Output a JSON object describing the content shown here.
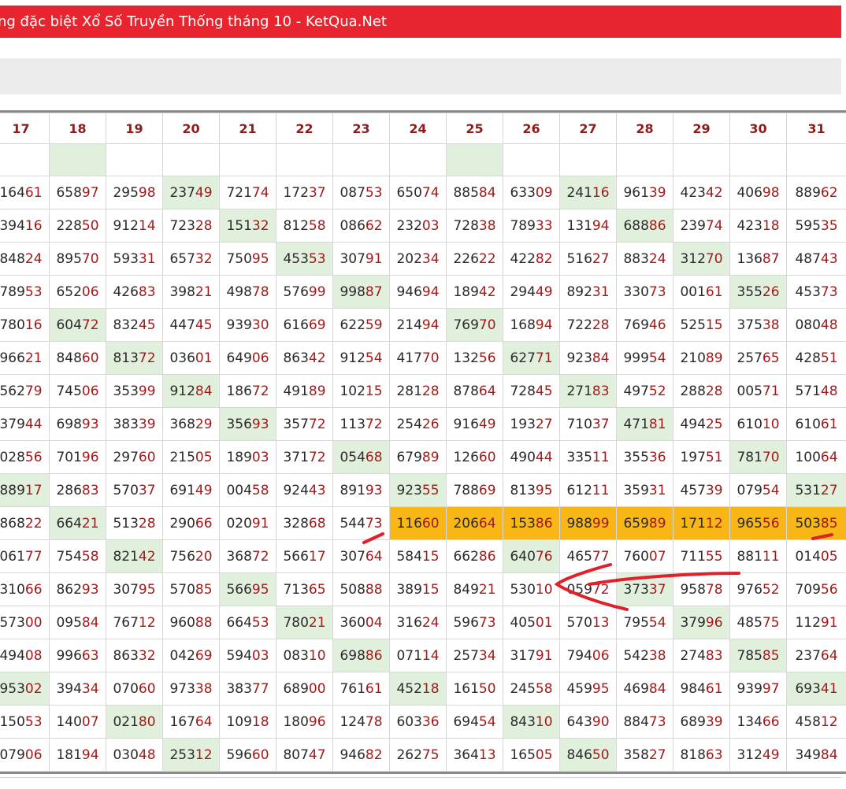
{
  "header": {
    "title": "ng đặc biệt Xổ Số Truyền Thống tháng 10 - KetQua.Net"
  },
  "table": {
    "columns": [
      "17",
      "18",
      "19",
      "20",
      "21",
      "22",
      "23",
      "24",
      "25",
      "26",
      "27",
      "28",
      "29",
      "30",
      "31"
    ],
    "first_row_green": [
      1,
      8
    ],
    "rows": [
      [
        "16461",
        "65897",
        "29598",
        "23749",
        "72174",
        "17237",
        "08753",
        "65074",
        "88584",
        "63309",
        "24116",
        "96139",
        "42342",
        "40698",
        "88962"
      ],
      [
        "39416",
        "22850",
        "91214",
        "72328",
        "15132",
        "81258",
        "08662",
        "23203",
        "72838",
        "78933",
        "13194",
        "68886",
        "23974",
        "42318",
        "59535"
      ],
      [
        "84824",
        "89570",
        "59331",
        "65732",
        "75095",
        "45353",
        "30791",
        "20234",
        "22622",
        "42282",
        "51627",
        "88324",
        "31270",
        "13687",
        "48743"
      ],
      [
        "78953",
        "65206",
        "42683",
        "39821",
        "49878",
        "57699",
        "99887",
        "94694",
        "18942",
        "29449",
        "89231",
        "33073",
        "00161",
        "35526",
        "45373"
      ],
      [
        "78016",
        "60472",
        "83245",
        "44745",
        "93930",
        "61669",
        "62259",
        "21494",
        "76970",
        "16894",
        "72228",
        "76946",
        "52515",
        "37538",
        "08048"
      ],
      [
        "96621",
        "84860",
        "81372",
        "03601",
        "64906",
        "86342",
        "91254",
        "41770",
        "13256",
        "62771",
        "92384",
        "99954",
        "21089",
        "25765",
        "42851"
      ],
      [
        "56279",
        "74506",
        "35399",
        "91284",
        "18672",
        "49189",
        "10215",
        "28128",
        "87864",
        "72845",
        "27183",
        "49752",
        "28828",
        "00571",
        "57148"
      ],
      [
        "37944",
        "69893",
        "38339",
        "36829",
        "35693",
        "35772",
        "11372",
        "25426",
        "91649",
        "19327",
        "71037",
        "47181",
        "49425",
        "61010",
        "61061"
      ],
      [
        "02856",
        "70196",
        "29760",
        "21505",
        "18903",
        "37172",
        "05468",
        "67989",
        "12660",
        "49044",
        "33511",
        "35536",
        "19751",
        "78170",
        "10064"
      ],
      [
        "88917",
        "28683",
        "57037",
        "69149",
        "00458",
        "92443",
        "89193",
        "92355",
        "78869",
        "81395",
        "61211",
        "35931",
        "45739",
        "07954",
        "53127"
      ],
      [
        "86822",
        "66421",
        "51328",
        "29066",
        "02091",
        "32868",
        "54473",
        "11660",
        "20664",
        "15386",
        "98899",
        "65989",
        "17112",
        "96556",
        "50385"
      ],
      [
        "06177",
        "75458",
        "82142",
        "75620",
        "36872",
        "56617",
        "30764",
        "58415",
        "66286",
        "64076",
        "46577",
        "76007",
        "71155",
        "88111",
        "01405"
      ],
      [
        "31066",
        "86293",
        "30795",
        "57085",
        "56695",
        "71365",
        "50888",
        "38915",
        "84921",
        "53010",
        "05972",
        "37337",
        "95878",
        "97652",
        "70956"
      ],
      [
        "57300",
        "09584",
        "76712",
        "96088",
        "66453",
        "78021",
        "36004",
        "31624",
        "59673",
        "40501",
        "57013",
        "79554",
        "37996",
        "48575",
        "11291"
      ],
      [
        "49408",
        "99663",
        "86332",
        "04269",
        "59403",
        "08310",
        "69886",
        "07114",
        "25734",
        "31791",
        "79406",
        "54238",
        "27483",
        "78585",
        "23764"
      ],
      [
        "95302",
        "39434",
        "07060",
        "97338",
        "38377",
        "68900",
        "76161",
        "45218",
        "16150",
        "24558",
        "45995",
        "46984",
        "98461",
        "93997",
        "69341"
      ],
      [
        "15053",
        "14007",
        "02180",
        "16764",
        "10918",
        "18096",
        "12478",
        "60336",
        "69454",
        "84310",
        "64390",
        "88473",
        "68939",
        "13466",
        "45812"
      ],
      [
        "07906",
        "18194",
        "03048",
        "25312",
        "59660",
        "80747",
        "94682",
        "26275",
        "36413",
        "16505",
        "84650",
        "35827",
        "81863",
        "31249",
        "34984"
      ]
    ],
    "green_cells": [
      [
        0,
        3
      ],
      [
        0,
        10
      ],
      [
        1,
        4
      ],
      [
        1,
        11
      ],
      [
        2,
        5
      ],
      [
        2,
        12
      ],
      [
        3,
        6
      ],
      [
        3,
        13
      ],
      [
        4,
        1
      ],
      [
        4,
        8
      ],
      [
        5,
        2
      ],
      [
        5,
        9
      ],
      [
        6,
        3
      ],
      [
        6,
        10
      ],
      [
        7,
        4
      ],
      [
        7,
        11
      ],
      [
        8,
        6
      ],
      [
        8,
        13
      ],
      [
        9,
        0
      ],
      [
        9,
        7
      ],
      [
        9,
        14
      ],
      [
        10,
        1
      ],
      [
        11,
        2
      ],
      [
        11,
        9
      ],
      [
        12,
        4
      ],
      [
        12,
        11
      ],
      [
        13,
        5
      ],
      [
        13,
        12
      ],
      [
        14,
        6
      ],
      [
        14,
        13
      ],
      [
        15,
        0
      ],
      [
        15,
        7
      ],
      [
        15,
        14
      ],
      [
        16,
        2
      ],
      [
        16,
        9
      ],
      [
        17,
        3
      ],
      [
        17,
        10
      ]
    ],
    "orange_row": 10,
    "orange_from_col": 7
  },
  "colors": {
    "header_red": "#e8252e",
    "highlight_green": "#e1f0dc",
    "highlight_orange": "#f8b617",
    "annotation_red": "#e0202a"
  }
}
